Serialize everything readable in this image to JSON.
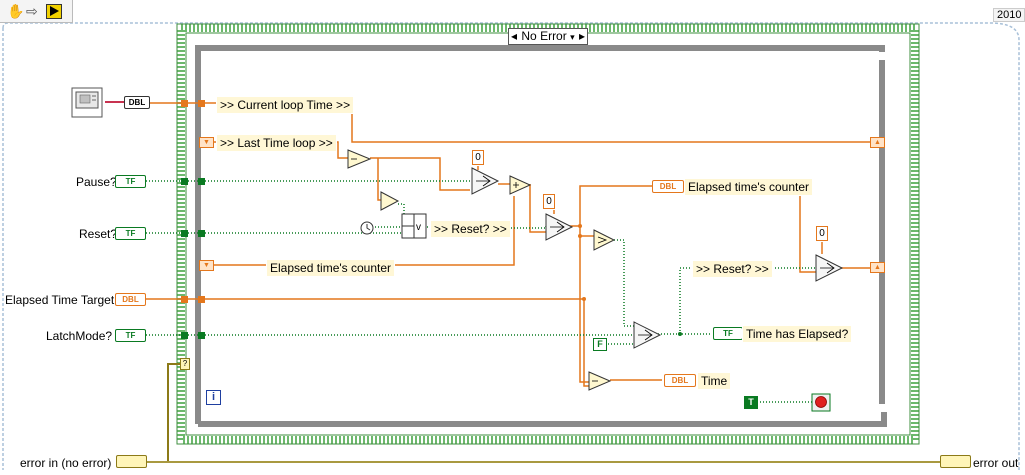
{
  "toolbar": {
    "icons": [
      "hand-icon",
      "arrow-icon",
      "run-icon"
    ]
  },
  "version_label": "2010",
  "case_selector": {
    "value": "No Error"
  },
  "controls_left": [
    {
      "label": "Pause?",
      "type": "TF"
    },
    {
      "label": "Reset?",
      "type": "TF"
    },
    {
      "label": "Elapsed Time Target",
      "type": "DBL"
    },
    {
      "label": "LatchMode?",
      "type": "TF"
    },
    {
      "label": "error in (no error)",
      "type": "cluster"
    }
  ],
  "tick_terminal": "DBL",
  "shift_labels": {
    "current_loop": ">> Current loop Time >>",
    "last_loop": ">> Last Time loop >>",
    "elapsed_counter_in": "Elapsed time's counter",
    "elapsed_counter_out": "Elapsed time's counter",
    "reset_in": ">> Reset? >>",
    "reset_out": ">> Reset? >>"
  },
  "constants": {
    "zero_1": "0",
    "zero_2": "0",
    "zero_3": "0",
    "false_const": "F",
    "true_const": "T"
  },
  "outputs": [
    {
      "label": "Time has Elapsed?",
      "type": "TF"
    },
    {
      "label": "Time",
      "type": "DBL"
    },
    {
      "label": "error out",
      "type": "cluster"
    }
  ],
  "loop_index": "i",
  "case_query": "?",
  "colors": {
    "numeric": "#e4771c",
    "boolean": "#0a7a22",
    "error": "#8c7a18",
    "loop_border": "#7a7a7a",
    "case_border": "#8fce8f"
  }
}
